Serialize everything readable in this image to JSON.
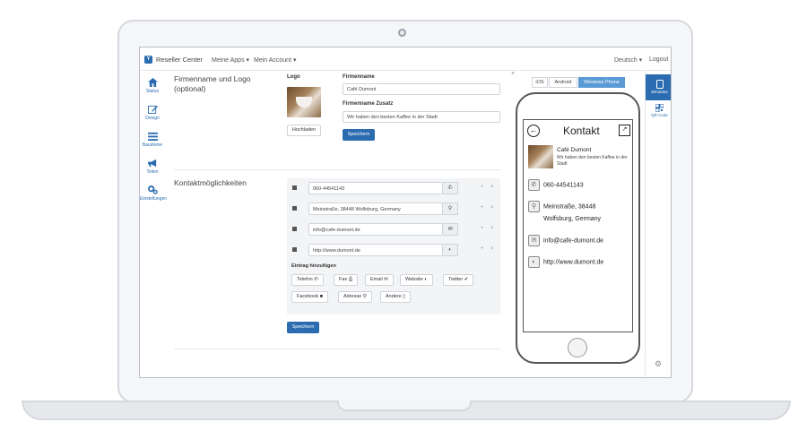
{
  "topnav": {
    "brand": "Reseller Center",
    "nav_items": [
      "Meine Apps ▾",
      "Mein Account ▾"
    ],
    "language": "Deutsch ▾",
    "logout": "Logout"
  },
  "sidebar": {
    "items": [
      {
        "label": "Status",
        "icon": "home-icon"
      },
      {
        "label": "Design",
        "icon": "edit-icon"
      },
      {
        "label": "Bausteine",
        "icon": "menu-icon"
      },
      {
        "label": "Teilen",
        "icon": "megaphone-icon"
      },
      {
        "label": "Einstellungen",
        "icon": "gears-icon"
      }
    ]
  },
  "company": {
    "section_title": "Firmenname und Logo (optional)",
    "logo_label": "Logo",
    "upload_label": "Hochladen",
    "name_label": "Firmenname",
    "name_value": "Café Dumont",
    "addon_label": "Firmenname Zusatz",
    "addon_value": "Wir haben den besten Kaffee in der Stadt",
    "save_label": "Speichern"
  },
  "contacts": {
    "section_title": "Kontaktmöglichkeiten",
    "rows": [
      {
        "value": "060-44541143",
        "icon": "phone-icon"
      },
      {
        "value": "Meinstraße, 38448 Wolfsburg, Germany",
        "icon": "map-pin-icon"
      },
      {
        "value": "info@cafe-dumont.de",
        "icon": "envelope-icon"
      },
      {
        "value": "http://www.dumont.de",
        "icon": "globe-icon"
      }
    ],
    "row_actions": "+ ×",
    "add_label": "Eintrag hinzufügen",
    "add_buttons": [
      "Telefon",
      "Fax",
      "Email",
      "Website",
      "Twitter",
      "Facebook",
      "Adresse",
      "Andere"
    ],
    "save_label": "Speichern"
  },
  "simulator": {
    "close": "×",
    "platforms": [
      "iOS",
      "Android",
      "Windows Phone"
    ],
    "active_platform": "Windows Phone",
    "phone": {
      "title": "Kontakt",
      "name": "Café Dumont",
      "subtitle": "Wir haben den besten Kaffee in der Stadt",
      "phone": "060-44541143",
      "address_line1": "Meinstraße, 38448",
      "address_line2": "Wolfsburg, Germany",
      "email": "info@cafe-dumont.de",
      "website": "http://www.dumont.de"
    }
  },
  "rightbar": {
    "simulator_label": "Simulator",
    "qr_label": "QR Code"
  },
  "colors": {
    "accent": "#2b6cb0",
    "active_segment": "#5b9bd5"
  }
}
